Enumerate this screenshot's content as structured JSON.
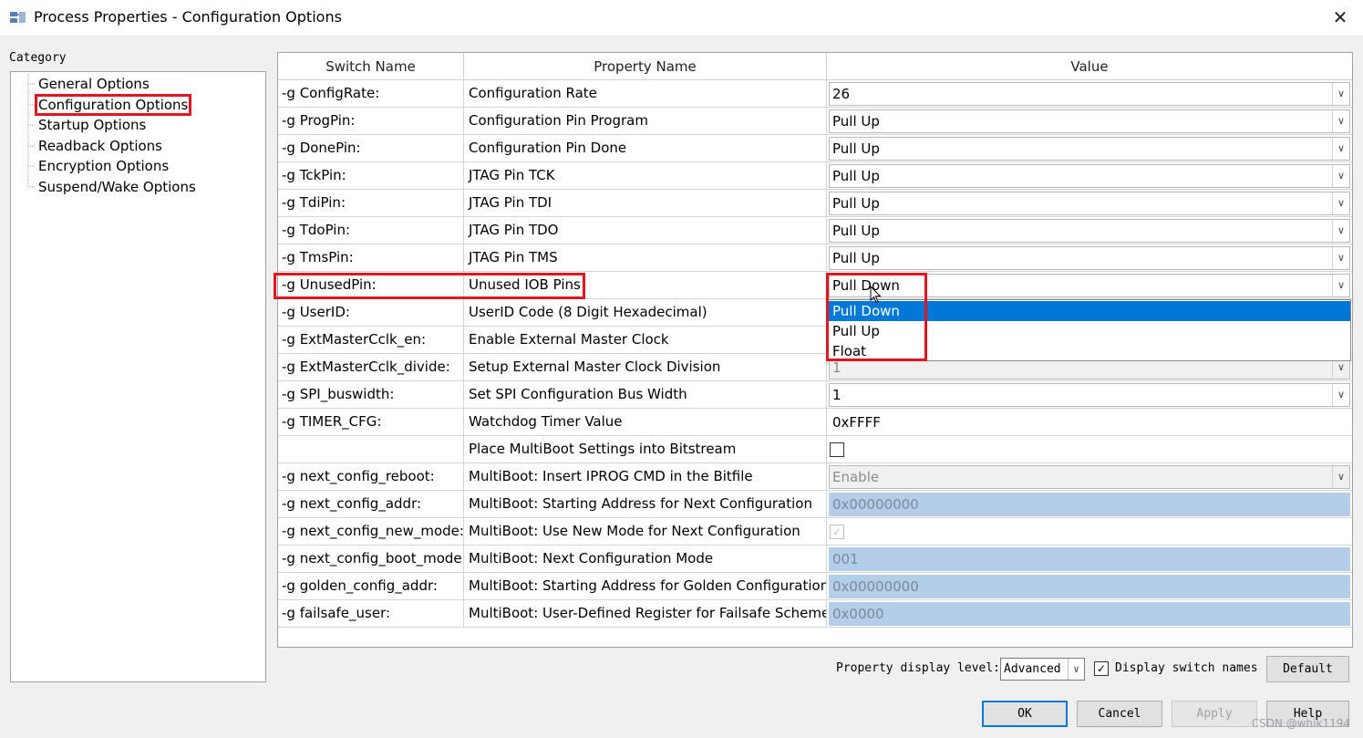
{
  "window": {
    "title": "Process Properties - Configuration Options",
    "close_glyph": "✕",
    "icon": "properties-icon"
  },
  "category": {
    "label": "Category",
    "items": [
      {
        "label": "General Options",
        "selected": false
      },
      {
        "label": "Configuration Options",
        "selected": true
      },
      {
        "label": "Startup Options",
        "selected": false
      },
      {
        "label": "Readback Options",
        "selected": false
      },
      {
        "label": "Encryption Options",
        "selected": false
      },
      {
        "label": "Suspend/Wake Options",
        "selected": false
      }
    ]
  },
  "grid": {
    "headers": [
      "Switch Name",
      "Property Name",
      "Value"
    ],
    "rows": [
      {
        "switch": "-g ConfigRate:",
        "property": "Configuration Rate",
        "value": "26",
        "type": "combo"
      },
      {
        "switch": "-g ProgPin:",
        "property": "Configuration Pin Program",
        "value": "Pull Up",
        "type": "combo"
      },
      {
        "switch": "-g DonePin:",
        "property": "Configuration Pin Done",
        "value": "Pull Up",
        "type": "combo"
      },
      {
        "switch": "-g TckPin:",
        "property": "JTAG Pin TCK",
        "value": "Pull Up",
        "type": "combo"
      },
      {
        "switch": "-g TdiPin:",
        "property": "JTAG Pin TDI",
        "value": "Pull Up",
        "type": "combo"
      },
      {
        "switch": "-g TdoPin:",
        "property": "JTAG Pin TDO",
        "value": "Pull Up",
        "type": "combo"
      },
      {
        "switch": "-g TmsPin:",
        "property": "JTAG Pin TMS",
        "value": "Pull Up",
        "type": "combo"
      },
      {
        "switch": "-g UnusedPin:",
        "property": "Unused IOB Pins",
        "value": "Pull Down",
        "type": "combo-open"
      },
      {
        "switch": "-g UserID:",
        "property": "UserID Code (8 Digit Hexadecimal)",
        "value": "",
        "type": "text"
      },
      {
        "switch": "-g ExtMasterCclk_en:",
        "property": "Enable External Master Clock",
        "value": "",
        "type": "text"
      },
      {
        "switch": "-g ExtMasterCclk_divide:",
        "property": "Setup External Master Clock Division",
        "value": "1",
        "type": "combo-disabled"
      },
      {
        "switch": "-g SPI_buswidth:",
        "property": "Set SPI Configuration Bus Width",
        "value": "1",
        "type": "combo"
      },
      {
        "switch": "-g TIMER_CFG:",
        "property": "Watchdog Timer Value",
        "value": "0xFFFF",
        "type": "text"
      },
      {
        "switch": "",
        "property": "Place MultiBoot Settings into Bitstream",
        "value": "",
        "type": "checkbox"
      },
      {
        "switch": "-g next_config_reboot:",
        "property": "MultiBoot: Insert IPROG CMD in the Bitfile",
        "value": "Enable",
        "type": "combo-disabled"
      },
      {
        "switch": "-g next_config_addr:",
        "property": "MultiBoot: Starting Address for Next Configuration",
        "value": "0x00000000",
        "type": "text-disabled"
      },
      {
        "switch": "-g next_config_new_mode:",
        "property": "MultiBoot: Use New Mode for Next Configuration",
        "value": "",
        "type": "checkbox-disabled"
      },
      {
        "switch": "-g next_config_boot_mode:",
        "property": "MultiBoot: Next Configuration Mode",
        "value": "001",
        "type": "text-disabled"
      },
      {
        "switch": "-g golden_config_addr:",
        "property": "MultiBoot: Starting Address for Golden Configuration",
        "value": "0x00000000",
        "type": "text-disabled"
      },
      {
        "switch": "-g failsafe_user:",
        "property": "MultiBoot: User-Defined Register for Failsafe Scheme",
        "value": "0x0000",
        "type": "text-disabled"
      }
    ]
  },
  "dropdown": {
    "options": [
      "Pull Down",
      "Pull Up",
      "Float"
    ],
    "highlighted": "Pull Down"
  },
  "footer": {
    "level_label": "Property display level:",
    "level_value": "Advanced",
    "display_switch_label": "Display switch names",
    "display_switch_checked": true,
    "default_label": "Default",
    "ok_label": "OK",
    "cancel_label": "Cancel",
    "apply_label": "Apply",
    "help_label": "Help"
  },
  "watermark": "CSDN @whik1194",
  "colors": {
    "highlight_red": "#e3161f",
    "selection_blue": "#0078d7",
    "disabled_fill": "#b4cde9"
  }
}
